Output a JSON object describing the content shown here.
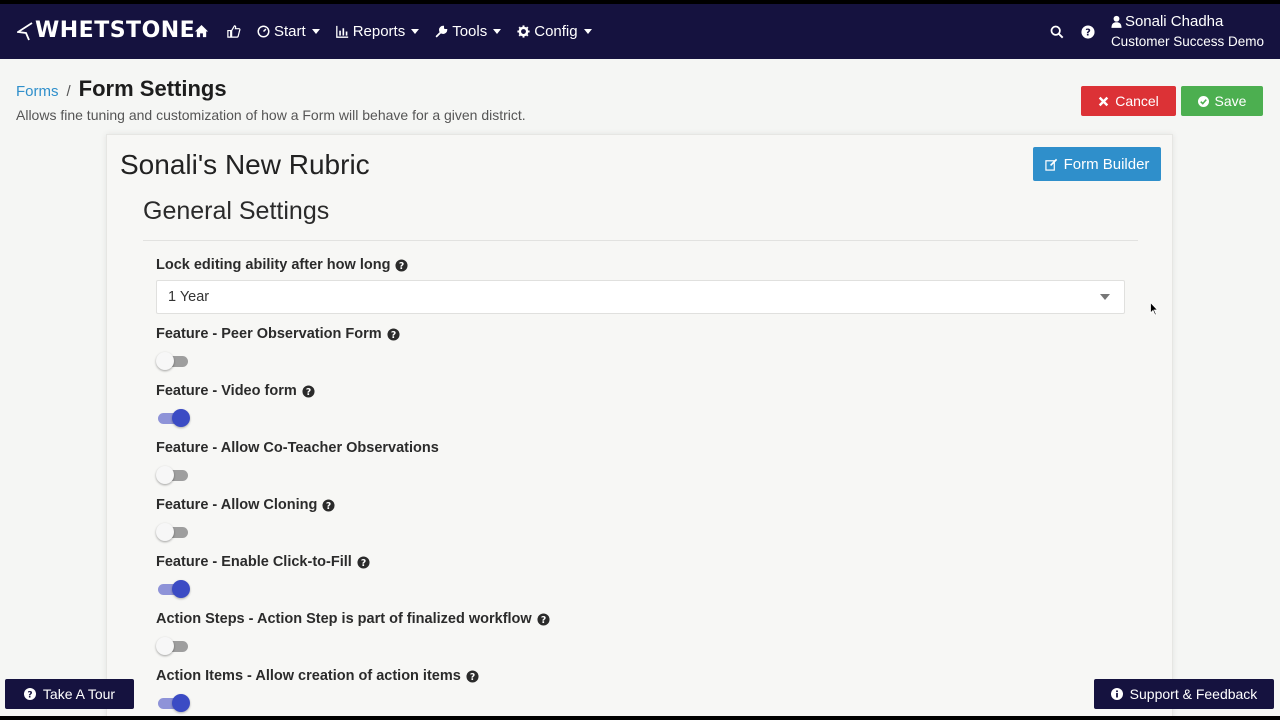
{
  "navbar": {
    "logo_text": "WHETSTONE",
    "menus": [
      {
        "label": "Start",
        "icon": "dashboard-icon"
      },
      {
        "label": "Reports",
        "icon": "bar-chart-icon"
      },
      {
        "label": "Tools",
        "icon": "wrench-icon"
      },
      {
        "label": "Config",
        "icon": "gear-icon"
      }
    ],
    "user_name": "Sonali Chadha",
    "user_org": "Customer Success Demo",
    "colors": {
      "bg": "#15123f"
    }
  },
  "header": {
    "breadcrumb_link": "Forms",
    "breadcrumb_sep": "/",
    "title": "Form Settings",
    "description": "Allows fine tuning and customization of how a Form will behave for a given district.",
    "cancel_label": "Cancel",
    "save_label": "Save",
    "colors": {
      "cancel": "#dc3236",
      "save": "#4caf50",
      "link": "#2f8fcb"
    }
  },
  "card": {
    "form_name": "Sonali's New Rubric",
    "form_builder_label": "Form Builder",
    "section_title": "General Settings",
    "lock_label": "Lock editing ability after how long",
    "lock_value": "1 Year",
    "settings": [
      {
        "label": "Feature - Peer Observation Form",
        "help": true,
        "on": false
      },
      {
        "label": "Feature - Video form",
        "help": true,
        "on": true
      },
      {
        "label": "Feature - Allow Co-Teacher Observations",
        "help": false,
        "on": false
      },
      {
        "label": "Feature - Allow Cloning",
        "help": true,
        "on": false
      },
      {
        "label": "Feature - Enable Click-to-Fill",
        "help": true,
        "on": true
      },
      {
        "label": "Action Steps - Action Step is part of finalized workflow",
        "help": true,
        "on": false
      },
      {
        "label": "Action Items - Allow creation of action items",
        "help": true,
        "on": true
      }
    ]
  },
  "floating": {
    "tour_label": "Take A Tour",
    "support_label": "Support & Feedback"
  }
}
